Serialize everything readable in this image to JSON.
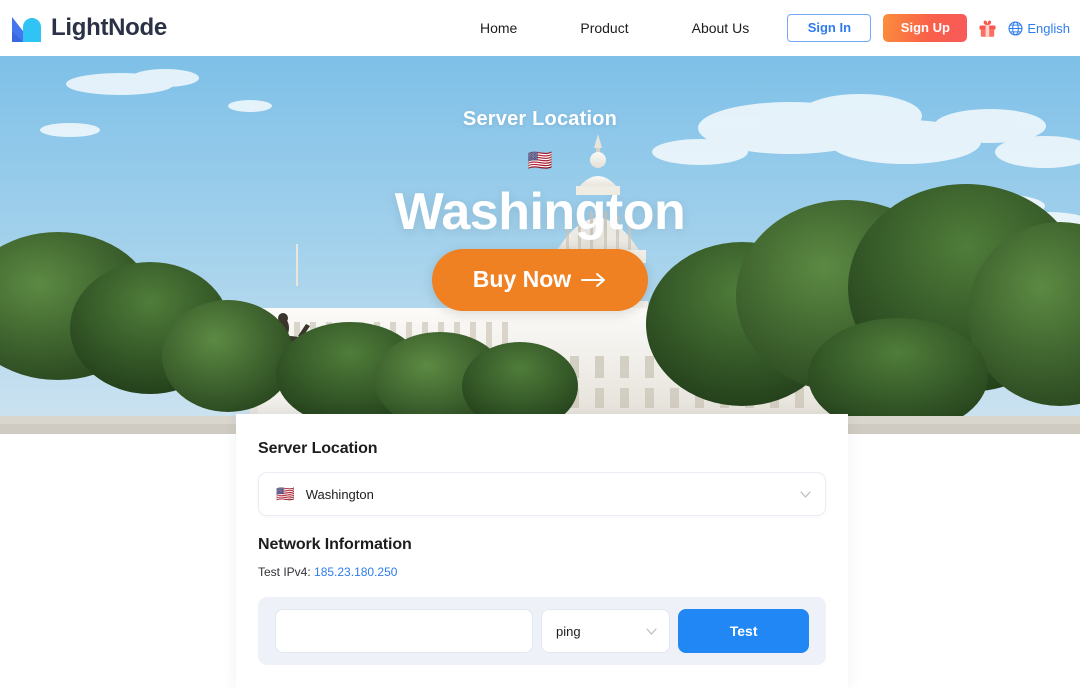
{
  "header": {
    "brand_name": "LightNode",
    "logo_icon": "lightnode-logo-icon",
    "nav": [
      {
        "label": "Home"
      },
      {
        "label": "Product"
      },
      {
        "label": "About Us"
      }
    ],
    "sign_in_label": "Sign In",
    "sign_up_label": "Sign Up",
    "gift_icon": "gift-icon",
    "globe_icon": "globe-icon",
    "language_label": "English"
  },
  "hero": {
    "kicker": "Server Location",
    "flag": "🇺🇸",
    "title": "Washington",
    "buy_label": "Buy Now",
    "arrow_icon": "arrow-right-icon"
  },
  "card": {
    "server_location_heading": "Server Location",
    "location_select": {
      "flag": "🇺🇸",
      "value": "Washington",
      "chevron_icon": "chevron-down-icon"
    },
    "network_information_heading": "Network Information",
    "ip_label": "Test IPv4:",
    "ip_value": "185.23.180.250",
    "test_bar": {
      "input_value": "",
      "input_placeholder": "",
      "method_value": "ping",
      "method_chevron_icon": "chevron-down-icon",
      "test_button_label": "Test"
    }
  },
  "colors": {
    "brand_dark": "#2b3245",
    "brand_blue": "#2f7ced",
    "accent_orange": "#f08122",
    "signup_gradient_start": "#fb8e3c",
    "signup_gradient_end": "#f85a5a",
    "test_blue": "#2087f5",
    "panel_bg": "#eef1f8"
  }
}
